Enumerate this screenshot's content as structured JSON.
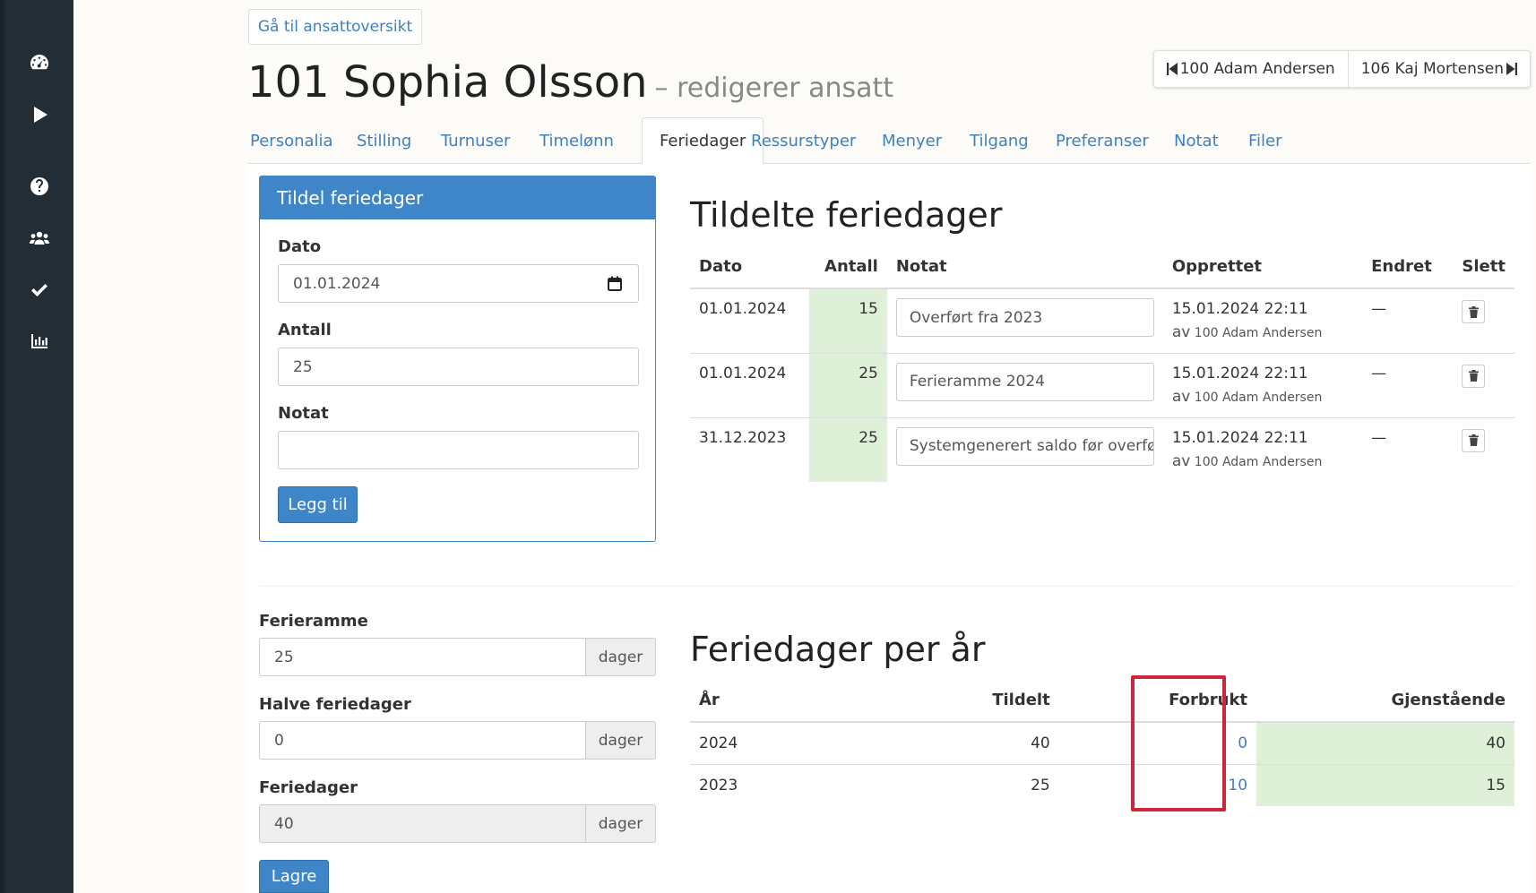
{
  "header": {
    "back_label": "Gå til ansattoversikt",
    "title": "101 Sophia Olsson",
    "subtitle": "– redigerer ansatt",
    "prev_employee": "100 Adam Andersen",
    "next_employee": "106 Kaj Mortensen"
  },
  "tabs": [
    "Personalia",
    "Stilling",
    "Turnuser",
    "Timelønn",
    "Feriedager",
    "Ressurstyper",
    "Menyer",
    "Tilgang",
    "Preferanser",
    "Notat",
    "Filer"
  ],
  "active_tab": "Feriedager",
  "assign_panel": {
    "title": "Tildel feriedager",
    "date_label": "Dato",
    "date_value": "01.01.2024",
    "amount_label": "Antall",
    "amount_value": "25",
    "note_label": "Notat",
    "note_value": "",
    "add_button": "Legg til"
  },
  "assigned": {
    "heading": "Tildelte feriedager",
    "columns": [
      "Dato",
      "Antall",
      "Notat",
      "Opprettet",
      "Endret",
      "Slett"
    ],
    "rows": [
      {
        "date": "01.01.2024",
        "amount": "15",
        "note": "Overført fra 2023",
        "created": "15.01.2024 22:11",
        "by_prefix": "av",
        "by": "100 Adam Andersen",
        "changed": "—"
      },
      {
        "date": "01.01.2024",
        "amount": "25",
        "note": "Ferieramme 2024",
        "created": "15.01.2024 22:11",
        "by_prefix": "av",
        "by": "100 Adam Andersen",
        "changed": "—"
      },
      {
        "date": "31.12.2023",
        "amount": "25",
        "note": "Systemgenerert saldo før overføring",
        "created": "15.01.2024 22:11",
        "by_prefix": "av",
        "by": "100 Adam Andersen",
        "changed": "—"
      }
    ]
  },
  "settings": {
    "frame_label": "Ferieramme",
    "frame_value": "25",
    "half_label": "Halve feriedager",
    "half_value": "0",
    "days_label": "Feriedager",
    "days_value": "40",
    "unit": "dager",
    "save_button": "Lagre"
  },
  "per_year": {
    "heading": "Feriedager per år",
    "columns": [
      "År",
      "Tildelt",
      "Forbrukt",
      "Gjenstående"
    ],
    "rows": [
      {
        "year": "2024",
        "assigned": "40",
        "used": "0",
        "remaining": "40"
      },
      {
        "year": "2023",
        "assigned": "25",
        "used": "10",
        "remaining": "15"
      }
    ]
  },
  "colors": {
    "primary": "#3f86c8",
    "link": "#3f7fc4",
    "success_bg": "#dff0d8",
    "highlight": "#c8283c",
    "sidebar": "#232d36"
  },
  "sidebar_icons": [
    "dashboard-icon",
    "play-icon",
    "help-icon",
    "users-icon",
    "check-icon",
    "chart-icon"
  ]
}
